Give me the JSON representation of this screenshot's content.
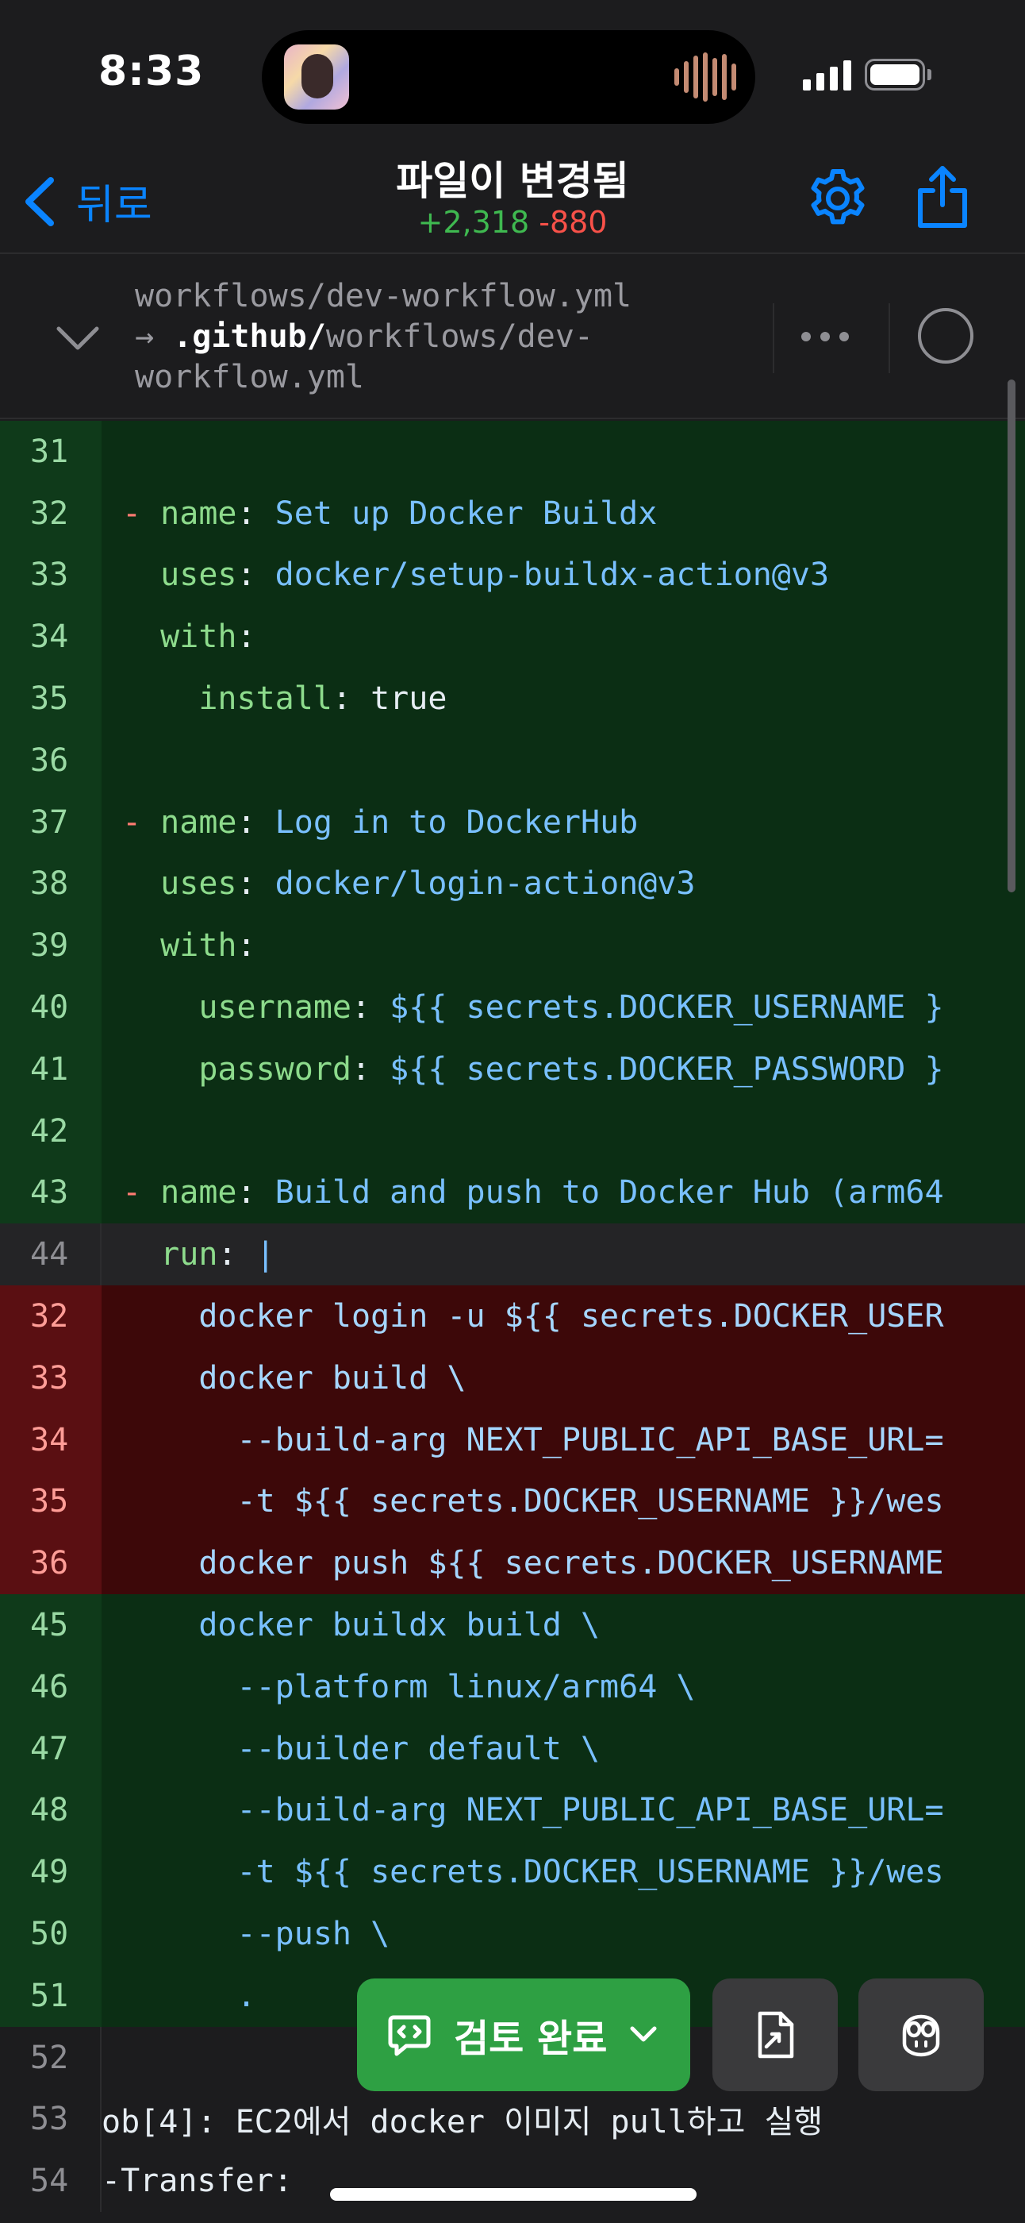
{
  "status_bar": {
    "time": "8:33"
  },
  "nav": {
    "back_label": "뒤로",
    "title": "파일이 변경됨",
    "additions": "+2,318",
    "deletions": "-880"
  },
  "file": {
    "old_path": "workflows/dev-workflow.yml",
    "arrow": "→ ",
    "new_path_bold": ".github/",
    "new_path_rest": "workflows/dev-",
    "new_path_end": "workflow.yml"
  },
  "code_lines": [
    {
      "num": "31",
      "kind": "add",
      "text": ""
    },
    {
      "num": "32",
      "kind": "add",
      "text": "- name: Set up Docker Buildx"
    },
    {
      "num": "33",
      "kind": "add",
      "text": "  uses: docker/setup-buildx-action@v3"
    },
    {
      "num": "34",
      "kind": "add",
      "text": "  with:"
    },
    {
      "num": "35",
      "kind": "add",
      "text": "    install: true"
    },
    {
      "num": "36",
      "kind": "add",
      "text": ""
    },
    {
      "num": "37",
      "kind": "add",
      "text": "- name: Log in to DockerHub"
    },
    {
      "num": "38",
      "kind": "add",
      "text": "  uses: docker/login-action@v3"
    },
    {
      "num": "39",
      "kind": "add",
      "text": "  with:"
    },
    {
      "num": "40",
      "kind": "add",
      "text": "    username: ${{ secrets.DOCKER_USERNAME }"
    },
    {
      "num": "41",
      "kind": "add",
      "text": "    password: ${{ secrets.DOCKER_PASSWORD }"
    },
    {
      "num": "42",
      "kind": "add",
      "text": ""
    },
    {
      "num": "43",
      "kind": "add",
      "text": "- name: Build and push to Docker Hub (arm64"
    },
    {
      "num": "44",
      "kind": "cur",
      "text": "  run: |"
    },
    {
      "num": "32",
      "kind": "del",
      "text": "    docker login -u ${{ secrets.DOCKER_USER"
    },
    {
      "num": "33",
      "kind": "del",
      "text": "    docker build \\"
    },
    {
      "num": "34",
      "kind": "del",
      "text": "      --build-arg NEXT_PUBLIC_API_BASE_URL="
    },
    {
      "num": "35",
      "kind": "del",
      "text": "      -t ${{ secrets.DOCKER_USERNAME }}/wes"
    },
    {
      "num": "36",
      "kind": "del",
      "text": "    docker push ${{ secrets.DOCKER_USERNAME"
    },
    {
      "num": "45",
      "kind": "add",
      "text": "    docker buildx build \\"
    },
    {
      "num": "46",
      "kind": "add",
      "text": "      --platform linux/arm64 \\"
    },
    {
      "num": "47",
      "kind": "add",
      "text": "      --builder default \\"
    },
    {
      "num": "48",
      "kind": "add",
      "text": "      --build-arg NEXT_PUBLIC_API_BASE_URL="
    },
    {
      "num": "49",
      "kind": "add",
      "text": "      -t ${{ secrets.DOCKER_USERNAME }}/wes"
    },
    {
      "num": "50",
      "kind": "add",
      "text": "      --push \\"
    },
    {
      "num": "51",
      "kind": "add",
      "text": "      ."
    },
    {
      "num": "52",
      "kind": "ctx",
      "text": ""
    },
    {
      "num": "53",
      "kind": "ctx",
      "text": "ob[4]: EC2에서 docker 이미지 pull하고 실행"
    },
    {
      "num": "54",
      "kind": "ctx",
      "text": "-Transfer:"
    }
  ],
  "review_button": {
    "label": "검토 완료"
  },
  "icons": {
    "back": "chevron-left-icon",
    "settings": "gear-icon",
    "share": "share-icon",
    "collapse": "chevron-down-icon",
    "more": "ellipsis-icon",
    "viewed": "circle-icon",
    "review": "comment-code-icon",
    "file": "file-diff-icon",
    "copilot": "copilot-icon"
  },
  "colors": {
    "accent": "#0a84ff",
    "additions": "#3fb950",
    "deletions": "#f85149",
    "review_button": "#2ea043"
  }
}
